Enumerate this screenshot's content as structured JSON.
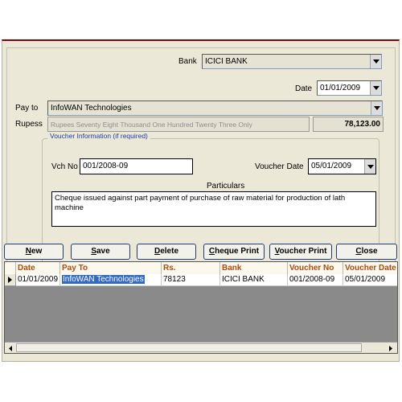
{
  "form": {
    "bank_label": "Bank",
    "bank_value": "ICICI BANK",
    "date_label": "Date",
    "date_value": "01/01/2009",
    "pay_to_label": "Pay to",
    "pay_to_value": "InfoWAN Technologies",
    "rupees_label": "Rupess",
    "rupees_words": "Rupees Seventy Eight Thousand One Hundred Twenty Three Only",
    "amount": "78,123.00"
  },
  "voucher": {
    "group_title": "Voucher Information (if required)",
    "vch_no_label": "Vch No",
    "vch_no_value": "001/2008-09",
    "voucher_date_label": "Voucher Date",
    "voucher_date_value": "05/01/2009",
    "particulars_label": "Particulars",
    "particulars_text": "Cheque issued against part payment of purchase of raw material for production of lath machine"
  },
  "buttons": {
    "new_u": "N",
    "new_rest": "ew",
    "save_u": "S",
    "save_rest": "ave",
    "delete_u": "D",
    "delete_rest": "elete",
    "cheque_pre": "C",
    "cheque_rest": "heque Print",
    "voucher_pre": "V",
    "voucher_rest": "oucher Print",
    "close_u": "C",
    "close_rest": "lose"
  },
  "grid": {
    "columns": [
      "Date",
      "Pay To",
      "Rs.",
      "Bank",
      "Voucher No",
      "Voucher Date"
    ],
    "rows": [
      [
        "01/01/2009",
        "InfoWAN Technologies",
        "78123",
        "ICICI BANK",
        "001/2008-09",
        "05/01/2009"
      ]
    ]
  },
  "icons": {
    "dropdown": "chevron-down-icon",
    "row_pointer": "triangle-right-icon",
    "scroll_left": "triangle-left-icon",
    "scroll_right": "triangle-right-icon"
  },
  "colors": {
    "window_bg": "#ebe8d8",
    "selection": "#316ac5",
    "header_text": "#b04a10",
    "group_title": "#1e3fa0",
    "top_border": "#8a0000"
  }
}
